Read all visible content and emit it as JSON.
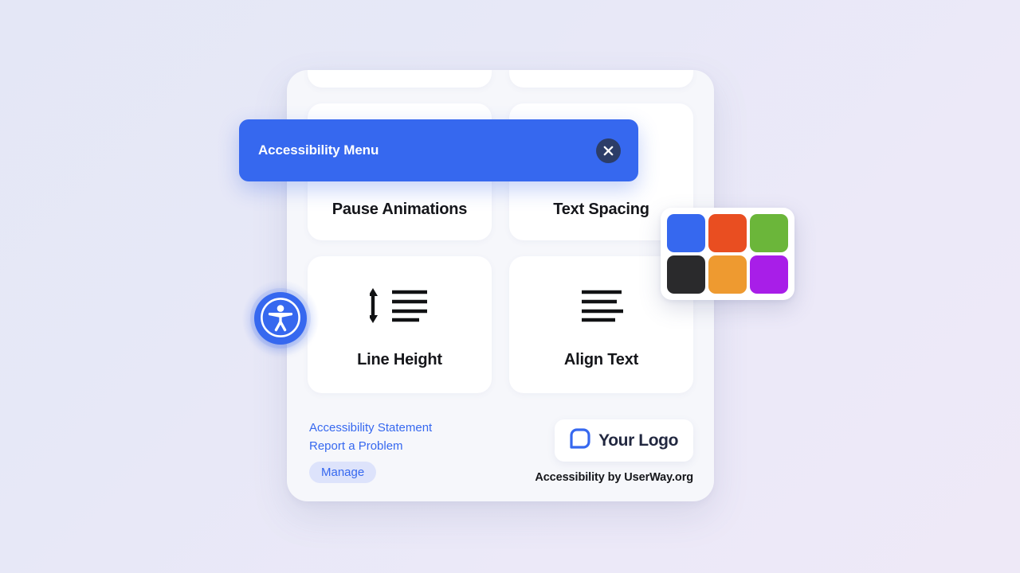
{
  "background": {
    "gradient_from": "#e4e7f6",
    "gradient_to": "#eee9f7"
  },
  "widget": {
    "title_bar": {
      "title": "Accessibility Menu",
      "background_color": "#3668ef",
      "title_color": "#ffffff",
      "close_icon": "close-icon",
      "close_label": "Close"
    },
    "cards": [
      {
        "id": "clipped-left",
        "label": "",
        "icon": "",
        "state": "clipped"
      },
      {
        "id": "clipped-right",
        "label": "",
        "icon": "",
        "state": "clipped"
      },
      {
        "id": "pause-animations",
        "label": "Pause Animations",
        "icon": "pause-animations-icon",
        "state": "partially-covered"
      },
      {
        "id": "text-spacing",
        "label": "Text Spacing",
        "icon": "text-spacing-icon",
        "state": "partially-covered"
      },
      {
        "id": "line-height",
        "label": "Line Height",
        "icon": "line-height-icon",
        "state": "visible"
      },
      {
        "id": "align-text",
        "label": "Align Text",
        "icon": "align-text-icon",
        "state": "visible"
      }
    ],
    "footer": {
      "links": [
        {
          "label": "Accessibility Statement",
          "name": "accessibility-statement-link"
        },
        {
          "label": "Report a Problem",
          "name": "report-a-problem-link"
        }
      ],
      "manage_label": "Manage",
      "manage_bg": "#dde3fb",
      "manage_color": "#3668ef",
      "logo_text": "Your Logo",
      "logo_icon": "brand-logo-icon",
      "byline": "Accessibility by UserWay.org"
    }
  },
  "floating_button": {
    "name": "accessibility-float-button",
    "icon": "accessibility-person-icon",
    "color": "#3668ef",
    "glow_color": "#567cf0"
  },
  "color_palette": {
    "name": "color-palette-popup",
    "swatches": [
      {
        "name": "swatch-blue",
        "color": "#3668ef"
      },
      {
        "name": "swatch-red",
        "color": "#e94e21"
      },
      {
        "name": "swatch-green",
        "color": "#6bb63a"
      },
      {
        "name": "swatch-black",
        "color": "#2a2a2c"
      },
      {
        "name": "swatch-orange",
        "color": "#ee9a30"
      },
      {
        "name": "swatch-purple",
        "color": "#a81ee8"
      }
    ]
  }
}
